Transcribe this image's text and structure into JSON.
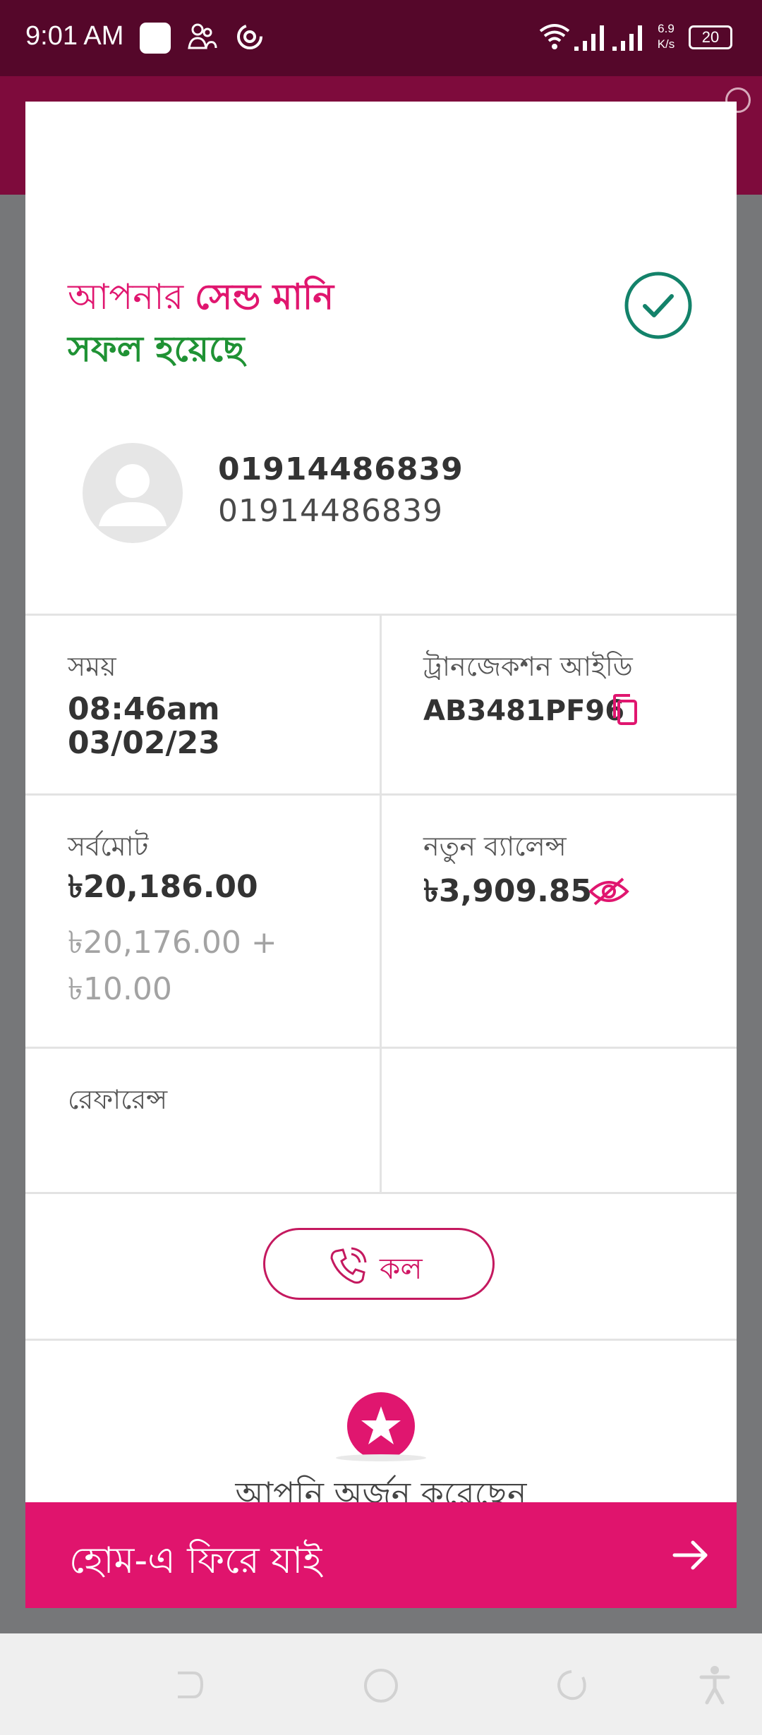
{
  "status_bar": {
    "time": "9:01 AM",
    "speed_top": "6.9",
    "speed_bottom": "K/s",
    "battery": "20"
  },
  "title": {
    "prefix": "আপনার ",
    "main": "সেন্ড মানি",
    "success": "সফল হয়েছে"
  },
  "recipient": {
    "name": "01914486839",
    "number": "01914486839"
  },
  "details": {
    "time_label": "সময়",
    "time_value": "08:46am",
    "date_value": "03/02/23",
    "txn_label": "ট্রানজেকশন আইডি",
    "txn_value": "AB3481PF96",
    "total_label": "সর্বমোট",
    "total_value": "৳20,186.00",
    "breakdown_amount": "৳20,176.00 +",
    "breakdown_fee": "৳10.00",
    "balance_label": "নতুন ব্যালেন্স",
    "balance_value": "৳3,909.85",
    "reference_label": "রেফারেন্স"
  },
  "call_button": {
    "label": "কল"
  },
  "reward": {
    "text": "আপনি অর্জন করেছেন"
  },
  "home_button": {
    "label": "হোম-এ ফিরে যাই"
  },
  "colors": {
    "accent": "#e0146d",
    "success": "#1f9234",
    "check": "#13826a",
    "status_bar": "#55072a"
  },
  "icons": [
    "check-circle-icon",
    "avatar-icon",
    "copy-icon",
    "eye-off-icon",
    "phone-icon",
    "star-icon",
    "arrow-right-icon"
  ]
}
